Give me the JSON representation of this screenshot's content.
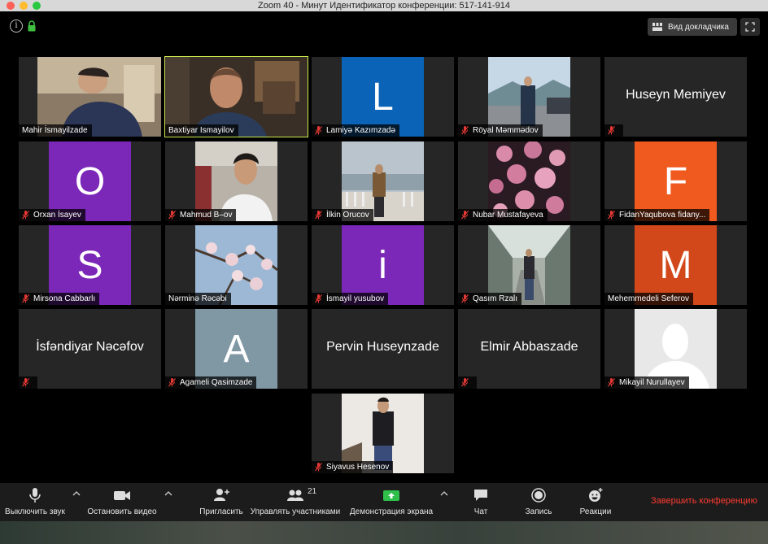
{
  "window": {
    "title": "Zoom   40 - Минут  Идентификатор конференции: 517-141-914"
  },
  "topbar": {
    "info_icon": "info-icon",
    "lock_icon": "lock-icon",
    "speaker_view_label": "Вид докладчика",
    "fullscreen_icon": "fullscreen-icon"
  },
  "colors": {
    "active_border": "#c8e84b",
    "end_meeting": "#ff3b30",
    "purple": "#7b27b8",
    "blue": "#0a63b6",
    "orange": "#f05a1e",
    "orange_red": "#d2481a",
    "gray_blue": "#7f98a4"
  },
  "participants": [
    {
      "name": "Mahir İsmayilzade",
      "type": "video",
      "muted": false
    },
    {
      "name": "Baxtiyar Ismayilov",
      "type": "video",
      "muted": false,
      "active": true
    },
    {
      "name": "Lamiyə Kazımzadə",
      "type": "letter",
      "letter": "L",
      "muted": true
    },
    {
      "name": "Röyal Məmmədov",
      "type": "video",
      "muted": true
    },
    {
      "name": "Huseyn Memiyev",
      "type": "name",
      "muted": true
    },
    {
      "name": "Orxan İsayev",
      "type": "letter",
      "letter": "O",
      "muted": true
    },
    {
      "name": "Mahmud B–ov",
      "type": "video",
      "muted": true
    },
    {
      "name": "İlkin Orucov",
      "type": "video",
      "muted": true
    },
    {
      "name": "Nubar Mustafayeva",
      "type": "video",
      "muted": true
    },
    {
      "name": "FidanYaqubova fidany...",
      "type": "letter",
      "letter": "F",
      "muted": true
    },
    {
      "name": "Mirsona Cabbarlı",
      "type": "letter",
      "letter": "S",
      "muted": true
    },
    {
      "name": "Nərminə Rəcəbi",
      "type": "video",
      "muted": false
    },
    {
      "name": "İsmayil yusubov",
      "type": "letter",
      "letter": "i",
      "muted": true
    },
    {
      "name": "Qasım Rzalı",
      "type": "video",
      "muted": true
    },
    {
      "name": "Mehemmedeli Seferov",
      "type": "letter",
      "letter": "M",
      "muted": false
    },
    {
      "name": "İsfəndiyar Nəcəfov",
      "type": "name",
      "muted": true
    },
    {
      "name": "Agameli Qasimzade",
      "type": "letter",
      "letter": "A",
      "muted": true
    },
    {
      "name": "Pervin Huseynzade",
      "type": "name",
      "muted": false
    },
    {
      "name": "Elmir Abbaszade",
      "type": "name",
      "muted": true
    },
    {
      "name": "Mikayil Nurullayev",
      "type": "avatar",
      "muted": true
    },
    {
      "name": "Siyavus Hesenov",
      "type": "video",
      "muted": true
    }
  ],
  "controls": {
    "mute_label": "Выключить звук",
    "video_label": "Остановить видео",
    "invite_label": "Пригласить",
    "participants_label": "Управлять участниками",
    "participants_count": "21",
    "share_label": "Демонстрация экрана",
    "chat_label": "Чат",
    "record_label": "Запись",
    "reactions_label": "Реакции",
    "end_label": "Завершить конференцию"
  }
}
